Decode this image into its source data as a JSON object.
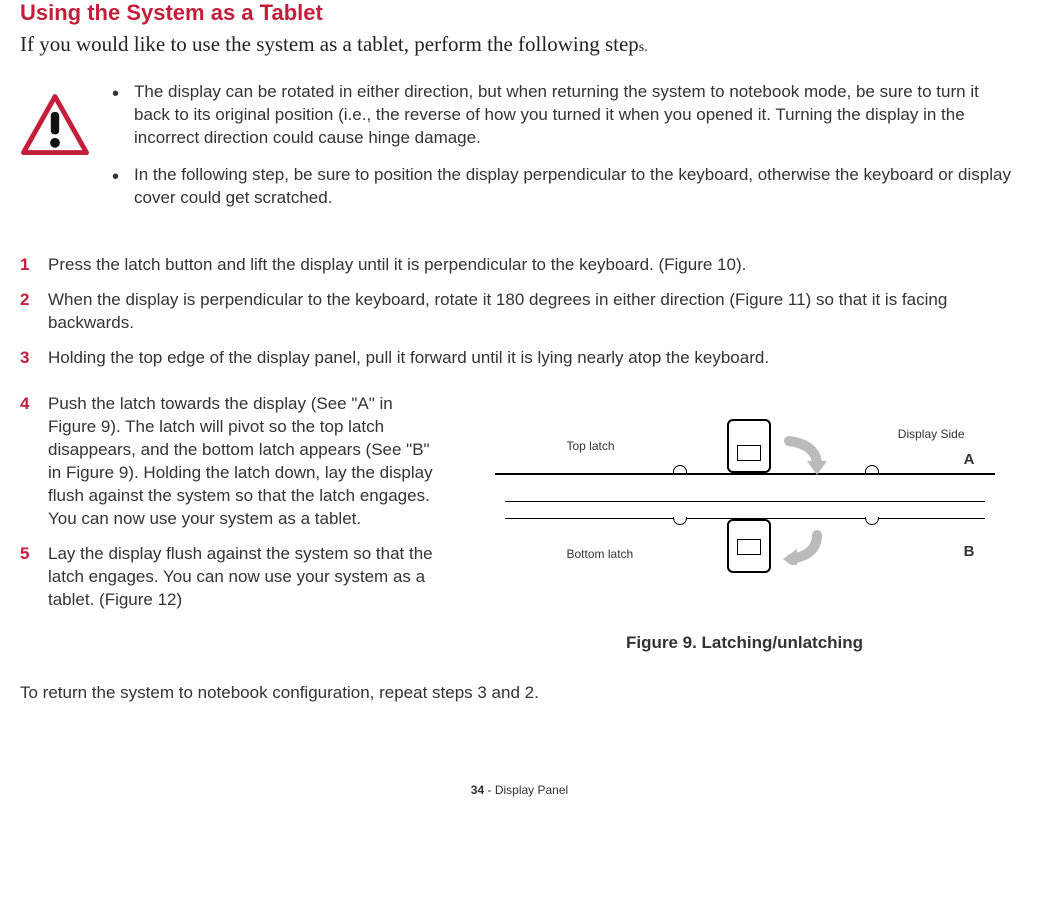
{
  "heading": "Using the System as a Tablet",
  "intro_main": "If you would like to use the system as a tablet, perform the following step",
  "intro_suffix": "s.",
  "warnings": [
    "The display can be rotated in either direction, but when returning the system to notebook mode, be sure to turn it back to its original position (i.e., the reverse of how you turned it when you opened it. Turning the display in the incorrect direction could cause hinge damage.",
    "In the following step, be sure to position the display perpendicular to the keyboard, otherwise the keyboard or display cover could get scratched."
  ],
  "steps_top": [
    {
      "num": "1",
      "text": "Press the latch button and lift the display until it is perpendicular to the keyboard. (Figure 10)."
    },
    {
      "num": "2",
      "text": "When the display is perpendicular to the keyboard, rotate it 180 degrees in either direction (Figure 11) so that it is facing backwards."
    },
    {
      "num": "3",
      "text": "Holding the top edge of the display panel, pull it forward until it is lying nearly atop the keyboard."
    }
  ],
  "steps_left": [
    {
      "num": "4",
      "text": "Push the latch towards the display (See \"A\" in Figure 9). The latch will pivot so the top latch disappears, and the bottom latch appears (See \"B\" in Figure 9). Holding the latch down, lay the display flush against the system so that the latch engages. You can now use your system as a tablet."
    },
    {
      "num": "5",
      "text": "Lay the display flush against the system so that the latch engages. You can now use your system as a tablet. (Figure 12)"
    }
  ],
  "diagram": {
    "top_latch": "Top latch",
    "display_side": "Display Side",
    "bottom_latch": "Bottom latch",
    "label_a": "A",
    "label_b": "B"
  },
  "figure_caption": "Figure 9.  Latching/unlatching",
  "return_text": "To return the system to notebook configuration, repeat steps 3 and 2.",
  "footer": {
    "page": "34",
    "section": " - Display Panel"
  }
}
